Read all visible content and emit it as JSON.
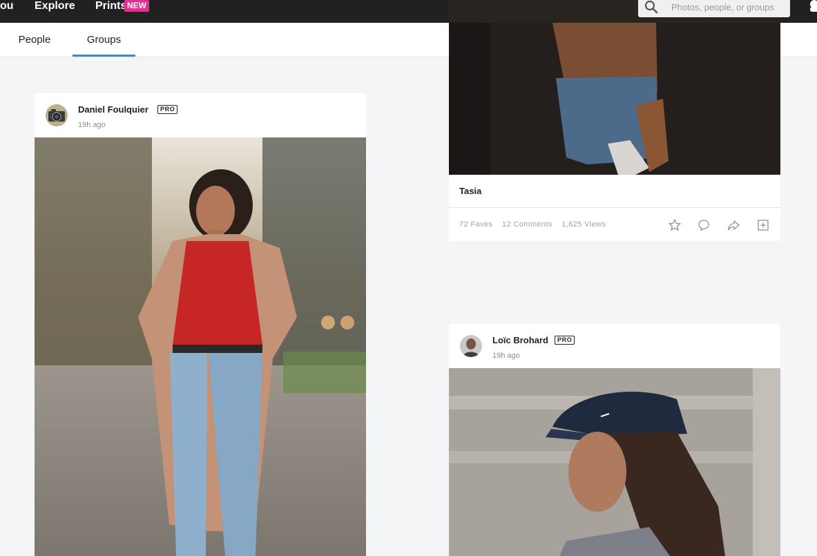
{
  "topnav": {
    "you_label": "ou",
    "explore_label": "Explore",
    "prints_label": "Prints",
    "prints_badge": "NEW",
    "search_placeholder": "Photos, people, or groups"
  },
  "tabs": [
    {
      "label": "People",
      "active": false
    },
    {
      "label": "Groups",
      "active": true
    }
  ],
  "colors": {
    "accent": "#1c98d6",
    "badge": "#e0308e",
    "topbar": "#212124"
  },
  "posts": [
    {
      "author": "Daniel Foulquier",
      "pro_badge": "PRO",
      "time": "19h ago",
      "avatar_icon": "camera-icon"
    },
    {
      "title": "Tasia",
      "faves": "72 Faves",
      "comments": "12 Comments",
      "views": "1,625 Views",
      "actions": [
        "star-icon",
        "comment-icon",
        "share-icon",
        "add-to-gallery-icon"
      ]
    },
    {
      "author": "Loïc Brohard",
      "pro_badge": "PRO",
      "time": "19h ago",
      "avatar_icon": "user-avatar"
    }
  ]
}
